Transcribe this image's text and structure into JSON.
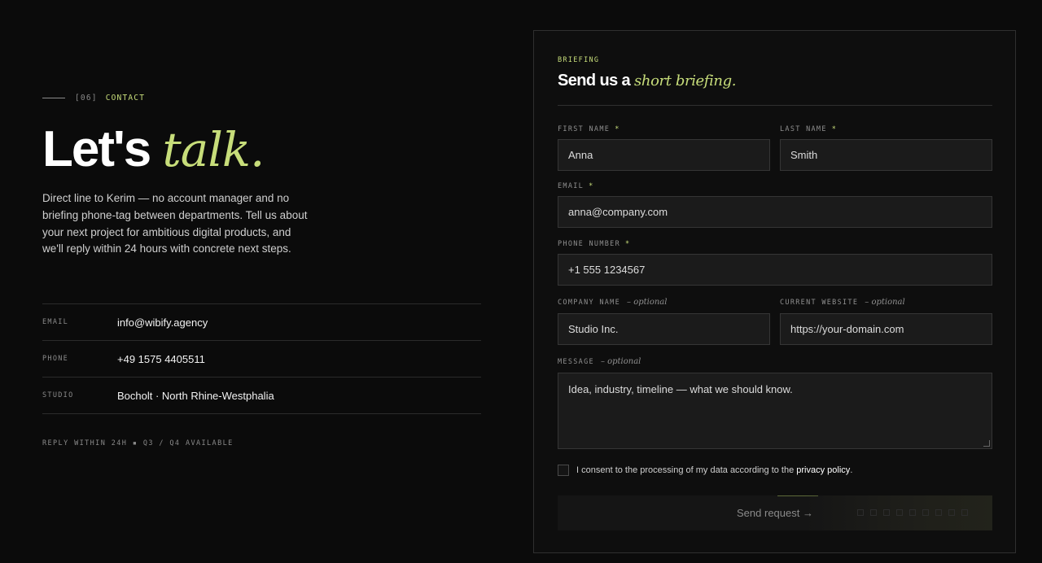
{
  "contact": {
    "section_number": "[06]",
    "section_label": "CONTACT",
    "headline_main": "Let's",
    "headline_accent": "talk.",
    "intro": "Direct line to Kerim — no account manager and no briefing phone-tag between departments. Tell us about your next project for ambitious digital products, and we'll reply within 24 hours with concrete next steps.",
    "details": [
      {
        "key": "EMAIL",
        "value": "info@wibify.agency"
      },
      {
        "key": "PHONE",
        "value": "+49 1575 4405511"
      },
      {
        "key": "STUDIO",
        "value": "Bocholt · North Rhine-Westphalia"
      }
    ],
    "footnote": "REPLY WITHIN 24H  ▪  Q3 / Q4 AVAILABLE"
  },
  "form": {
    "eyebrow": "BRIEFING",
    "title_main": "Send us a",
    "title_accent": "short briefing.",
    "required_mark": "*",
    "optional_mark": "– optional",
    "first_name": {
      "label": "FIRST NAME",
      "value": "Anna"
    },
    "last_name": {
      "label": "LAST NAME",
      "value": "Smith"
    },
    "email": {
      "label": "EMAIL",
      "value": "anna@company.com"
    },
    "phone": {
      "label": "PHONE NUMBER",
      "value": "+1 555 1234567"
    },
    "company": {
      "label": "COMPANY NAME",
      "value": "Studio Inc."
    },
    "website": {
      "label": "CURRENT WEBSITE",
      "value": "https://your-domain.com"
    },
    "message": {
      "label": "MESSAGE",
      "placeholder": "Idea, industry, timeline — what we should know."
    },
    "consent_text": "I consent to the processing of my data according to the",
    "consent_link": "privacy policy",
    "consent_end": ".",
    "submit_label": "Send request →"
  },
  "colors": {
    "background": "#0b0b0b",
    "accent": "#c7dd7a",
    "input_bg": "#1b1b1b",
    "border": "#353535"
  }
}
